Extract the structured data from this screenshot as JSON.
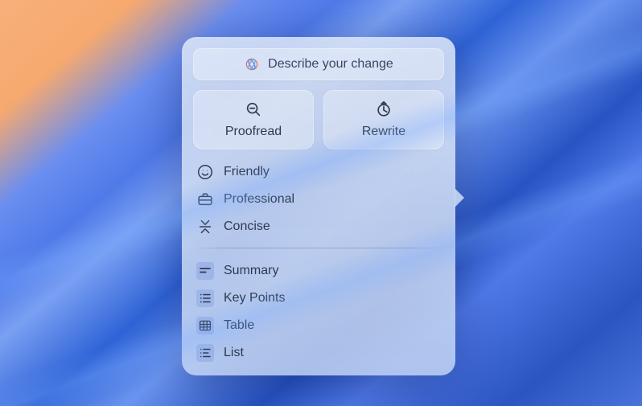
{
  "panel": {
    "describe_label": "Describe your change",
    "actions": {
      "proofread": "Proofread",
      "rewrite": "Rewrite"
    },
    "tones": [
      {
        "label": "Friendly"
      },
      {
        "label": "Professional"
      },
      {
        "label": "Concise"
      }
    ],
    "outputs": [
      {
        "label": "Summary"
      },
      {
        "label": "Key Points"
      },
      {
        "label": "Table"
      },
      {
        "label": "List"
      }
    ]
  }
}
